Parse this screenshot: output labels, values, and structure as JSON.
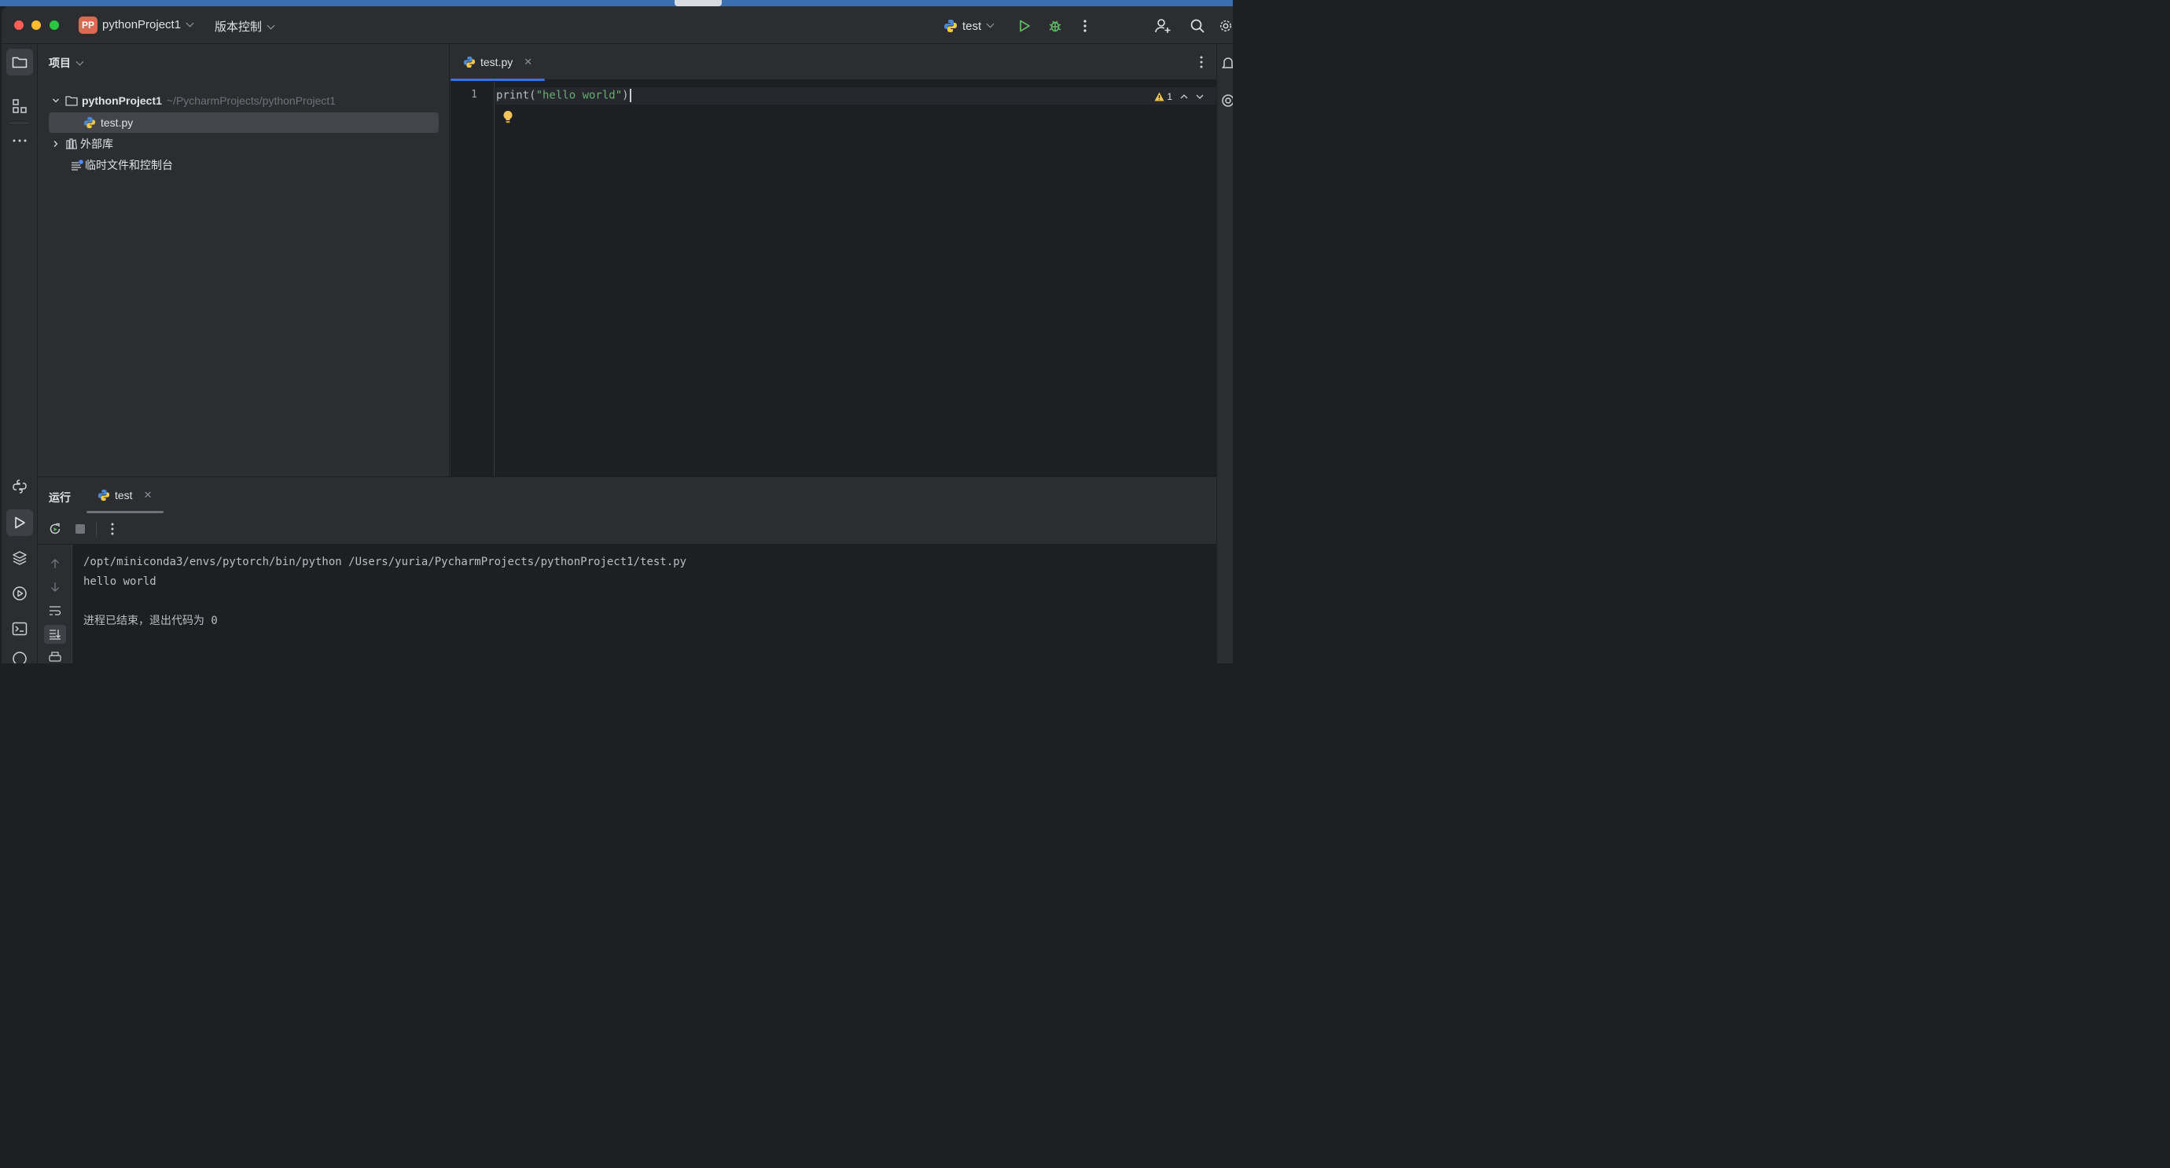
{
  "title_bar": {
    "project_badge": "PP",
    "project_name": "pythonProject1",
    "vcs_label": "版本控制",
    "run_config": "test"
  },
  "project_panel": {
    "title": "项目",
    "root_name": "pythonProject1",
    "root_path": "~/PycharmProjects/pythonProject1",
    "items": [
      {
        "label": "test.py"
      },
      {
        "label": "外部库"
      },
      {
        "label": "临时文件和控制台"
      }
    ]
  },
  "editor": {
    "tab_label": "test.py",
    "line_number": "1",
    "code_fn": "print(",
    "code_str": "\"hello world\"",
    "code_end": ")",
    "warning_count": "1"
  },
  "run_panel": {
    "title": "运行",
    "tab_label": "test",
    "console_lines": [
      "/opt/miniconda3/envs/pytorch/bin/python /Users/yuria/PycharmProjects/pythonProject1/test.py",
      "hello world",
      "",
      "进程已结束，退出代码为 0"
    ]
  },
  "colors": {
    "accent": "#3574f0",
    "string": "#6aab73",
    "run_green": "#5fb865",
    "warning": "#f2c55c"
  }
}
